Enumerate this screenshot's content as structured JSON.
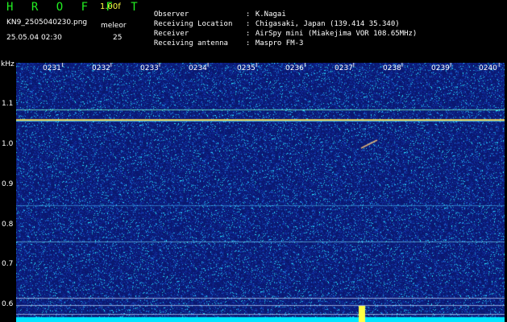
{
  "header": {
    "app_title": "H R O F F T",
    "version": "1.00f",
    "filename": "KN9_2505040230.png",
    "mode": "meleor",
    "datetime": "25.05.04 02:30",
    "count": "25"
  },
  "station_info": [
    {
      "label": "Observer",
      "value": "K.Nagai"
    },
    {
      "label": "Receiving Location",
      "value": "Chigasaki, Japan (139.414 35.340)"
    },
    {
      "label": "Receiver",
      "value": "AirSpy mini (Miakejima VOR 108.65MHz)"
    },
    {
      "label": "Receiving antenna",
      "value": "Maspro FM-3"
    }
  ],
  "axes": {
    "y_unit": "kHz",
    "y_labels": [
      "1.1",
      "1.0",
      "0.9",
      "0.8",
      "0.7",
      "0.6"
    ],
    "time_labels": [
      "0231",
      "0232",
      "0233",
      "0234",
      "0235",
      "0236",
      "0237",
      "0238",
      "0239",
      "0240"
    ]
  },
  "colors": {
    "background": "#000000",
    "spectrogram_base": "#0a1870",
    "title_green": "#22ee22",
    "version_yellow": "#ffff44",
    "bottom_bar": "#00e5ff"
  }
}
